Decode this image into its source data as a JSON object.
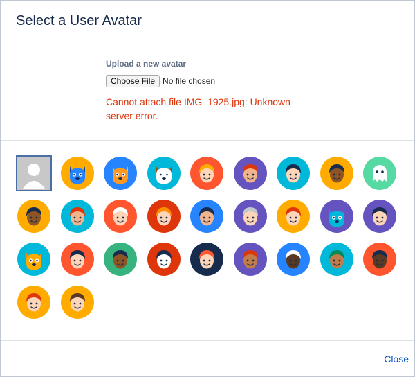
{
  "dialog": {
    "title": "Select a User Avatar",
    "upload": {
      "label": "Upload a new avatar",
      "button_label": "Choose File",
      "file_status": "No file chosen",
      "error": "Cannot attach file IMG_1925.jpg: Unknown server error."
    },
    "footer": {
      "close_label": "Close"
    }
  },
  "colors": {
    "error": "#de350b",
    "link": "#0052cc",
    "title": "#172b4d"
  },
  "avatars": [
    {
      "name": "default-avatar",
      "bg": "#c8c8c8",
      "skin": "#ffffff",
      "hair": "#c8c8c8",
      "kind": "default",
      "selected": true
    },
    {
      "name": "robot-avatar",
      "bg": "#ffab00",
      "skin": "#2684ff",
      "hair": "#0747a6",
      "kind": "animal"
    },
    {
      "name": "cat-avatar",
      "bg": "#2684ff",
      "skin": "#ff991f",
      "hair": "#ffc400",
      "kind": "animal"
    },
    {
      "name": "dog-avatar",
      "bg": "#00b8d9",
      "skin": "#ffffff",
      "hair": "#974f0c",
      "kind": "animal"
    },
    {
      "name": "person-avatar",
      "bg": "#ff5630",
      "skin": "#ffd5b8",
      "hair": "#ffab00",
      "kind": "person"
    },
    {
      "name": "person-avatar",
      "bg": "#6554c0",
      "skin": "#f2b48a",
      "hair": "#de350b",
      "kind": "person"
    },
    {
      "name": "person-avatar",
      "bg": "#00b8d9",
      "skin": "#ffd5b8",
      "hair": "#172b4d",
      "kind": "person"
    },
    {
      "name": "person-avatar",
      "bg": "#ffab00",
      "skin": "#8d5524",
      "hair": "#172b4d",
      "kind": "person"
    },
    {
      "name": "ghost-avatar",
      "bg": "#57d9a3",
      "skin": "#ffffff",
      "hair": "#ffffff",
      "kind": "ghost"
    },
    {
      "name": "person-avatar",
      "bg": "#ffab00",
      "skin": "#8d5524",
      "hair": "#172b4d",
      "kind": "person"
    },
    {
      "name": "person-avatar",
      "bg": "#00b8d9",
      "skin": "#f2b48a",
      "hair": "#de350b",
      "kind": "person"
    },
    {
      "name": "person-avatar",
      "bg": "#ff5630",
      "skin": "#ffd5b8",
      "hair": "#ffffff",
      "kind": "person"
    },
    {
      "name": "person-avatar",
      "bg": "#de350b",
      "skin": "#ffd5b8",
      "hair": "#ff8b00",
      "kind": "person"
    },
    {
      "name": "person-avatar",
      "bg": "#2684ff",
      "skin": "#f2b48a",
      "hair": "#172b4d",
      "kind": "person"
    },
    {
      "name": "person-avatar",
      "bg": "#6554c0",
      "skin": "#ffd5b8",
      "hair": "#c1c7d0",
      "kind": "person"
    },
    {
      "name": "person-avatar",
      "bg": "#ffab00",
      "skin": "#ffd5b8",
      "hair": "#de350b",
      "kind": "person"
    },
    {
      "name": "owl-avatar",
      "bg": "#6554c0",
      "skin": "#00b8d9",
      "hair": "#2684ff",
      "kind": "animal"
    },
    {
      "name": "pirate-avatar",
      "bg": "#6554c0",
      "skin": "#ffd5b8",
      "hair": "#172b4d",
      "kind": "person"
    },
    {
      "name": "robot-avatar",
      "bg": "#00b8d9",
      "skin": "#ffab00",
      "hair": "#ff8b00",
      "kind": "animal"
    },
    {
      "name": "person-avatar",
      "bg": "#ff5630",
      "skin": "#ffd5b8",
      "hair": "#172b4d",
      "kind": "person"
    },
    {
      "name": "person-avatar",
      "bg": "#36b37e",
      "skin": "#8d5524",
      "hair": "#172b4d",
      "kind": "person"
    },
    {
      "name": "person-avatar",
      "bg": "#de350b",
      "skin": "#ffffff",
      "hair": "#172b4d",
      "kind": "person"
    },
    {
      "name": "person-avatar",
      "bg": "#172b4d",
      "skin": "#ffd5b8",
      "hair": "#ff5630",
      "kind": "person"
    },
    {
      "name": "person-avatar",
      "bg": "#6554c0",
      "skin": "#c17c4a",
      "hair": "#de350b",
      "kind": "person"
    },
    {
      "name": "person-avatar",
      "bg": "#2684ff",
      "skin": "#5a3a22",
      "hair": "#ffffff",
      "kind": "person"
    },
    {
      "name": "person-avatar",
      "bg": "#00b8d9",
      "skin": "#c17c4a",
      "hair": "#00875a",
      "kind": "person"
    },
    {
      "name": "person-avatar",
      "bg": "#ff5630",
      "skin": "#5a3a22",
      "hair": "#172b4d",
      "kind": "person"
    },
    {
      "name": "person-avatar",
      "bg": "#ffab00",
      "skin": "#ffd5b8",
      "hair": "#de350b",
      "kind": "person"
    },
    {
      "name": "person-avatar",
      "bg": "#ffab00",
      "skin": "#ffd5b8",
      "hair": "#5a3a22",
      "kind": "person"
    }
  ]
}
